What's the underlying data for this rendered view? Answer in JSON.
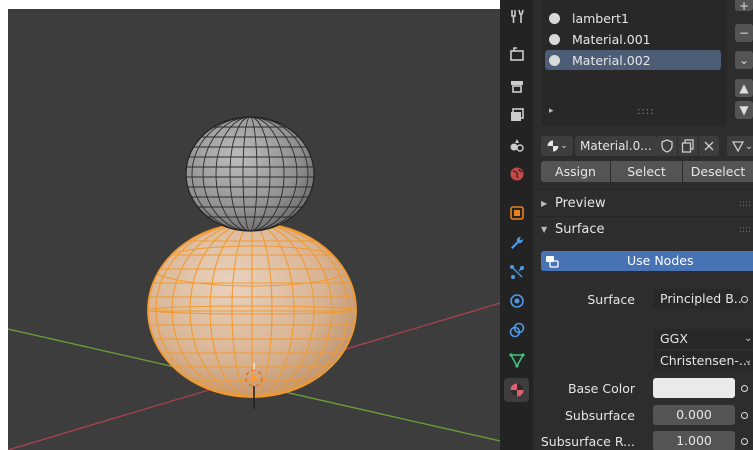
{
  "materials": {
    "items": [
      {
        "name": "lambert1",
        "selected": false
      },
      {
        "name": "Material.001",
        "selected": false
      },
      {
        "name": "Material.002",
        "selected": true
      }
    ],
    "list_expand_arrow": "▸",
    "grip": "::::"
  },
  "side_buttons": [
    "+",
    "−",
    "⌄",
    "▲",
    "▼"
  ],
  "slot": {
    "name": "Material.0...",
    "browse_chevron": "⌄"
  },
  "actions": {
    "assign": "Assign",
    "select": "Select",
    "deselect": "Deselect"
  },
  "sections": {
    "preview": "Preview",
    "surface": "Surface",
    "collapsed_arrow": "▶",
    "expanded_arrow": "▼",
    "grip": "::::"
  },
  "surface": {
    "use_nodes": "Use Nodes",
    "surface_label": "Surface",
    "surface_value": "Principled B...",
    "distribution": "GGX",
    "subsurface_method": "Christensen-...",
    "base_color_label": "Base Color",
    "base_color": "#eaeaea",
    "subsurface_label": "Subsurface",
    "subsurface_value": "0.000",
    "subsurface_radius_label": "Subsurface R...",
    "subsurface_radius_value": "1.000"
  },
  "tabs": [
    "tool",
    "render",
    "output",
    "view-layer",
    "scene",
    "world",
    "object",
    "modifiers",
    "particles",
    "physics",
    "constraints",
    "data",
    "material"
  ],
  "colors": {
    "selection_orange": "#ff9933",
    "active_highlight": "#4772b3",
    "x_axis": "#c24b5a",
    "y_axis": "#6b9a3a"
  }
}
